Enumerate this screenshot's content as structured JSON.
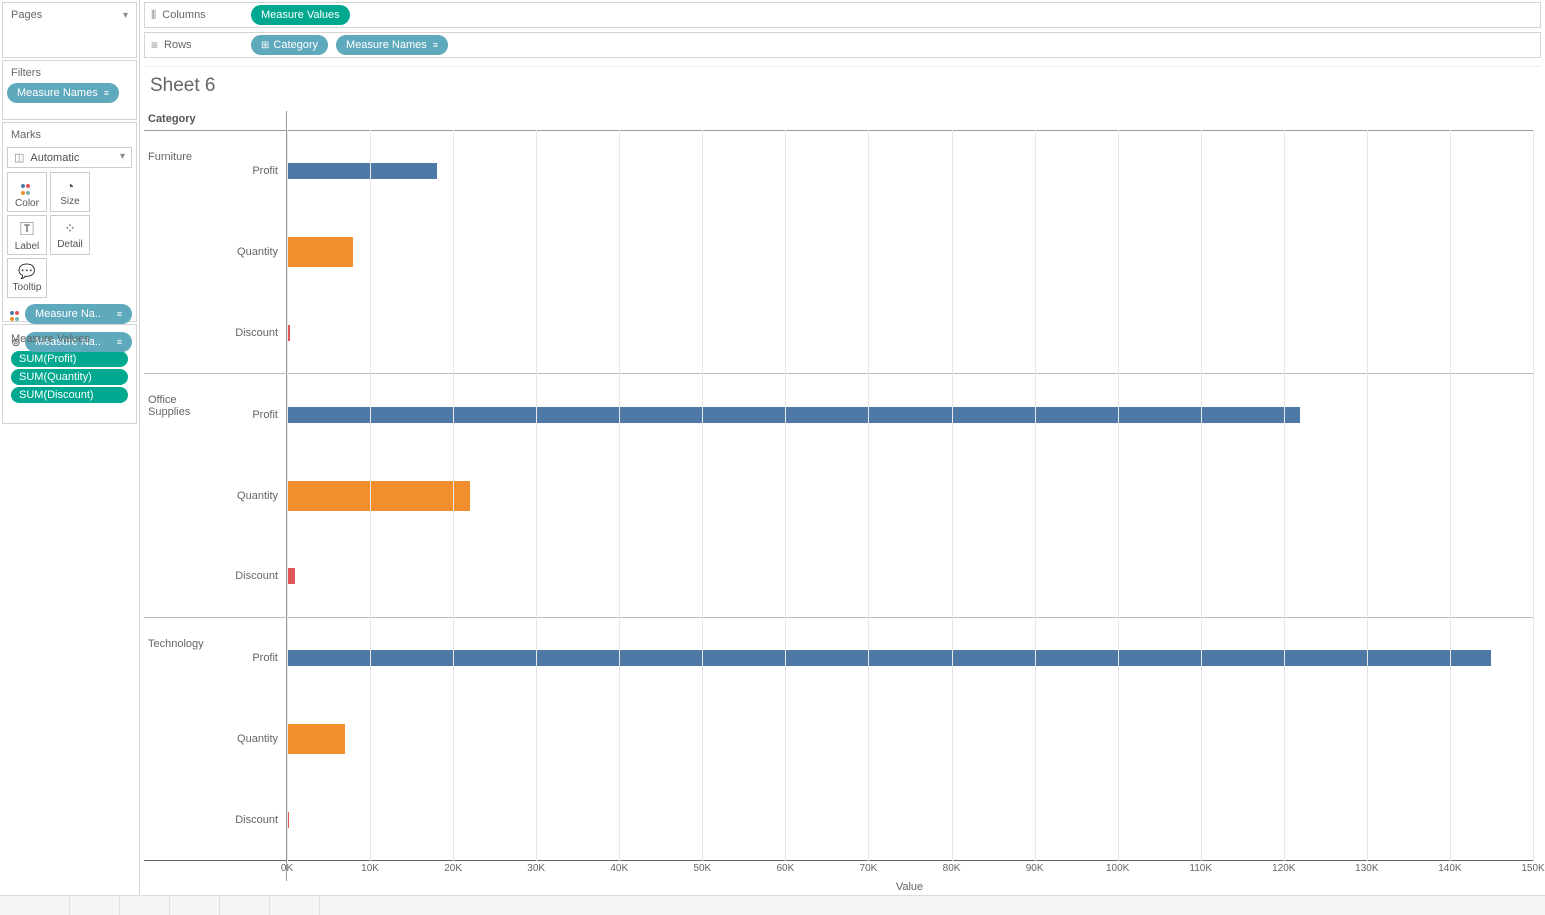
{
  "shelves": {
    "columns_label": "Columns",
    "rows_label": "Rows",
    "columns_pills": [
      "Measure Values"
    ],
    "rows_pills": [
      {
        "label": "Category",
        "expand": true
      },
      {
        "label": "Measure Names",
        "sort": true
      }
    ]
  },
  "pages": {
    "title": "Pages"
  },
  "filters": {
    "title": "Filters",
    "pills": [
      {
        "label": "Measure Names",
        "sort": true
      }
    ]
  },
  "marks": {
    "title": "Marks",
    "type": "Automatic",
    "cells": [
      "Color",
      "Size",
      "Label",
      "Detail",
      "Tooltip"
    ],
    "pills": [
      {
        "icon": "dots",
        "label": "Measure Na..",
        "sort": true
      },
      {
        "icon": "detail",
        "label": "Measure Na..",
        "sort": true
      }
    ]
  },
  "measure_values": {
    "title": "Measure Values",
    "items": [
      "SUM(Profit)",
      "SUM(Quantity)",
      "SUM(Discount)"
    ]
  },
  "sheet": {
    "title": "Sheet 6",
    "category_header": "Category",
    "xlabel": "Value"
  },
  "chart_data": {
    "type": "bar",
    "xlabel": "Value",
    "xlim": [
      0,
      150000
    ],
    "xticks": [
      0,
      10000,
      20000,
      30000,
      40000,
      50000,
      60000,
      70000,
      80000,
      90000,
      100000,
      110000,
      120000,
      130000,
      140000,
      150000
    ],
    "xtick_labels": [
      "0K",
      "10K",
      "20K",
      "30K",
      "40K",
      "50K",
      "60K",
      "70K",
      "80K",
      "90K",
      "100K",
      "110K",
      "120K",
      "130K",
      "140K",
      "150K"
    ],
    "measures": [
      "Profit",
      "Quantity",
      "Discount"
    ],
    "colors": {
      "Profit": "#4e79a7",
      "Quantity": "#f28e2b",
      "Discount": "#e15759"
    },
    "categories": [
      {
        "name": "Furniture",
        "values": {
          "Profit": 18000,
          "Quantity": 8000,
          "Discount": 400
        }
      },
      {
        "name": "Office Supplies",
        "values": {
          "Profit": 122000,
          "Quantity": 22000,
          "Discount": 1000
        }
      },
      {
        "name": "Technology",
        "values": {
          "Profit": 145000,
          "Quantity": 7000,
          "Discount": 300
        }
      }
    ]
  }
}
